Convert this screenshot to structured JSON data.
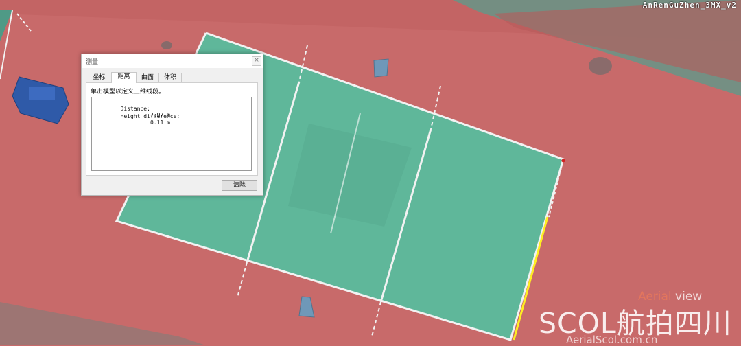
{
  "scene": {
    "project_title": "AnRenGuZhen_3MX_v2",
    "colors": {
      "track": "#c86a6a",
      "court": "#5fb79a",
      "lines": "#f2f2f2",
      "measurement": "#ffee22",
      "grass": "#4f9a86"
    }
  },
  "dialog": {
    "title": "测量",
    "close_glyph": "×",
    "tabs": [
      {
        "label": "坐标",
        "active": false
      },
      {
        "label": "距离",
        "active": true
      },
      {
        "label": "曲面",
        "active": false
      },
      {
        "label": "体积",
        "active": false
      }
    ],
    "prompt": "单击模型以定义三维线段。",
    "results": [
      {
        "label": "Distance:",
        "value": "7.97 m"
      },
      {
        "label": "Height difference:",
        "value": "0.11 m"
      }
    ],
    "clear_button": "清除"
  },
  "watermark": {
    "view_text_a": "Aerial",
    "view_text_b": " view",
    "logo": "SCOL航拍四川",
    "site": "AerialScol.com.cn"
  }
}
